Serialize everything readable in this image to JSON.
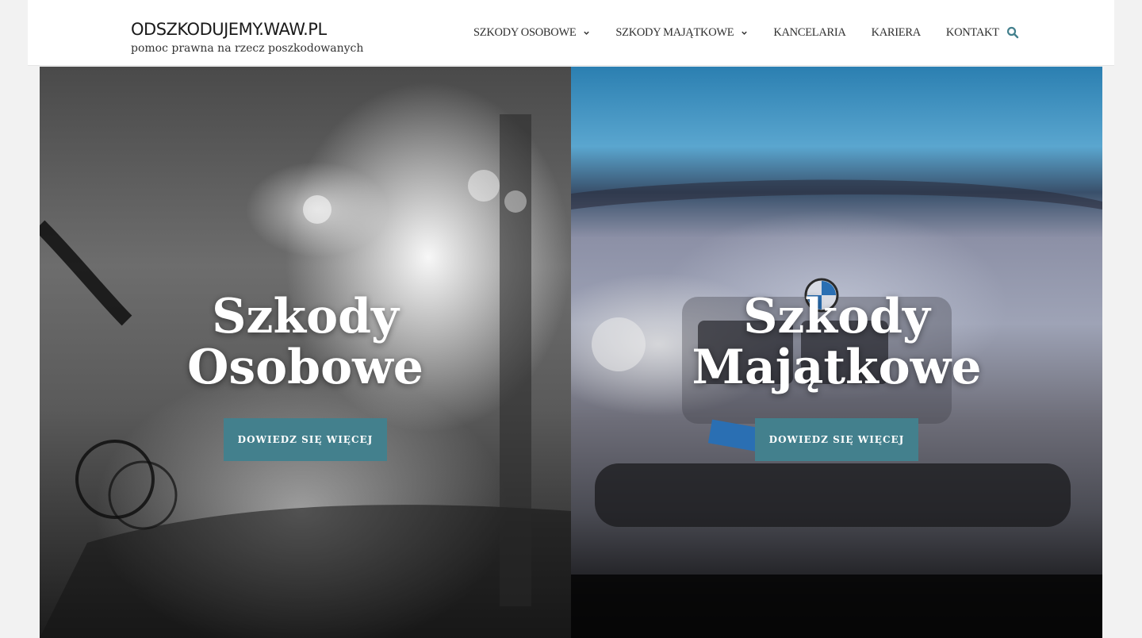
{
  "header": {
    "logo_text": "ODSZKODUJEMY.WAW.PL",
    "tagline": "pomoc prawna na rzecz poszkodowanych",
    "nav": [
      {
        "label": "SZKODY OSOBOWE",
        "has_dropdown": true
      },
      {
        "label": "SZKODY MAJĄTKOWE",
        "has_dropdown": true
      },
      {
        "label": "KANCELARIA",
        "has_dropdown": false
      },
      {
        "label": "KARIERA",
        "has_dropdown": false
      },
      {
        "label": "KONTAKT",
        "has_dropdown": false
      }
    ],
    "search_icon": "search-icon"
  },
  "panels": [
    {
      "title_line1": "Szkody",
      "title_line2": "Osobowe",
      "button_label": "DOWIEDZ SIĘ WIĘCEJ",
      "image": "cyclist-at-night-photo"
    },
    {
      "title_line1": "Szkody",
      "title_line2": "Majątkowe",
      "button_label": "DOWIEDZ SIĘ WIĘCEJ",
      "image": "damaged-car-front-photo"
    }
  ],
  "colors": {
    "accent": "#43808d",
    "nav_text": "#2f2f2f",
    "search_icon": "#43808d"
  }
}
